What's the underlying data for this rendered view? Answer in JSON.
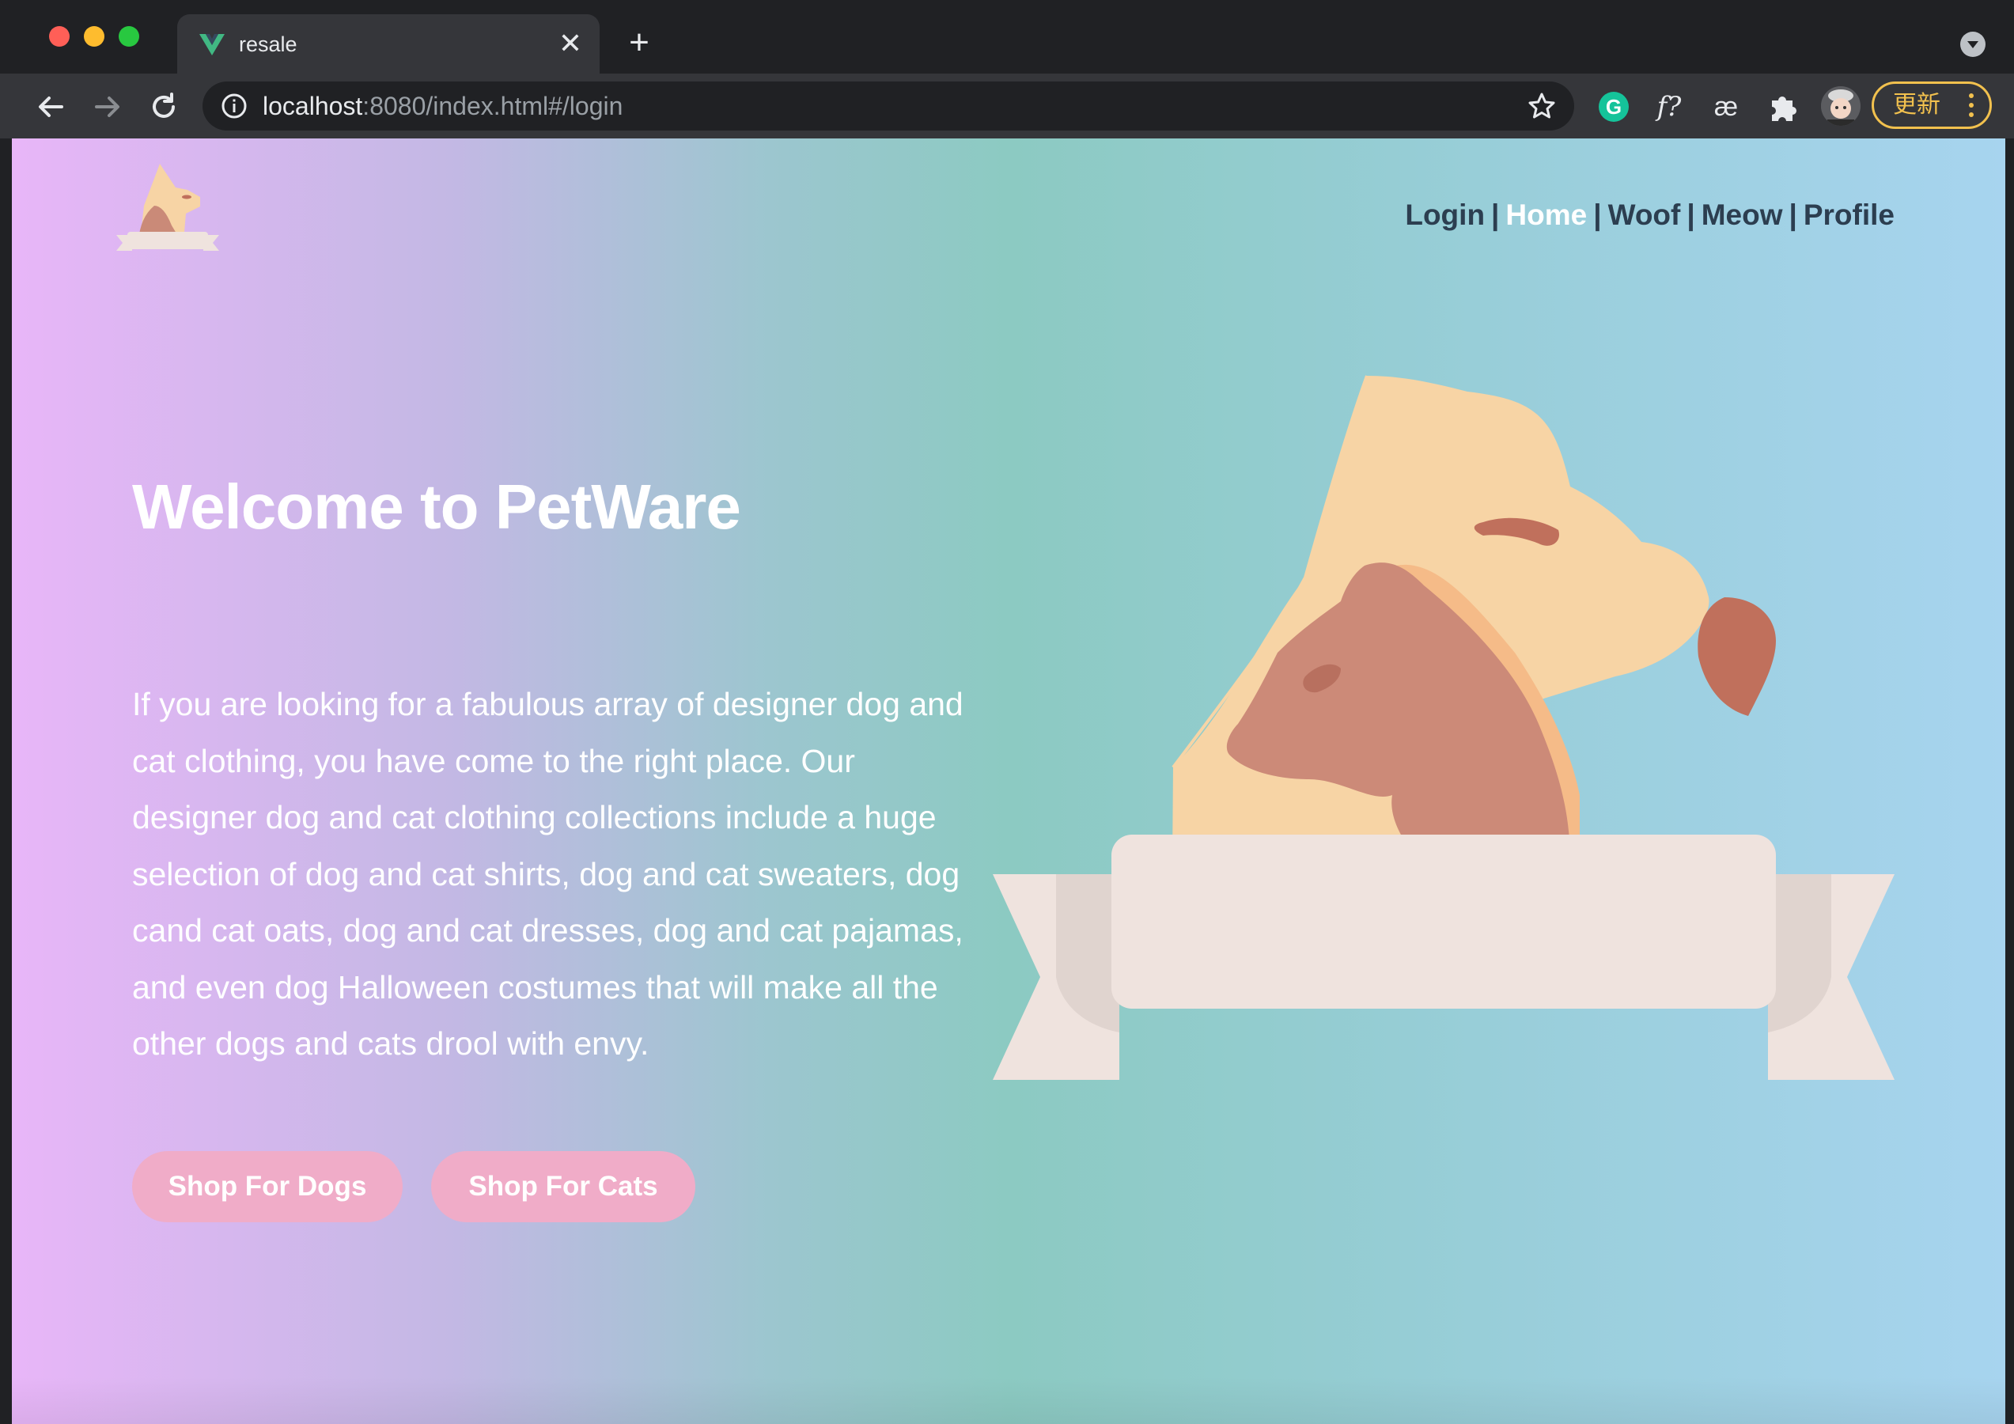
{
  "browser": {
    "tab": {
      "title": "resale",
      "close_glyph": "✕",
      "favicon": "vue-logo-icon"
    },
    "new_tab_glyph": "+",
    "address_bar": {
      "host": "localhost",
      "path": ":8080/index.html#/login"
    },
    "extensions": {
      "grammarly": "G",
      "formula": "f?",
      "ae": "æ"
    },
    "update_button_label": "更新",
    "colors": {
      "frame": "#202124",
      "toolbar": "#35363a",
      "update_accent": "#f2c14e"
    }
  },
  "site": {
    "nav": {
      "links": [
        "Login",
        "Home",
        "Woof",
        "Meow",
        "Profile"
      ],
      "active": "Home",
      "separator": "|"
    },
    "hero": {
      "title": "Welcome to PetWare",
      "text": "If you are looking for a fabulous array of designer dog and cat clothing, you have come to the right place. Our designer dog and cat clothing collections include a huge selection of dog and cat shirts, dog and cat sweaters, dog cand cat oats, dog and cat dresses, dog and cat pajamas, and even dog Halloween costumes that will make all the other dogs and cats drool with envy."
    },
    "buttons": {
      "dogs": "Shop For Dogs",
      "cats": "Shop For Cats"
    },
    "colors": {
      "gradient_left": "#e8b6f8",
      "gradient_mid": "#8ccac2",
      "gradient_right": "#a7d4ef",
      "button": "#f0acc8",
      "nav_text": "#2c3e50",
      "nav_active": "#ffffff"
    }
  }
}
